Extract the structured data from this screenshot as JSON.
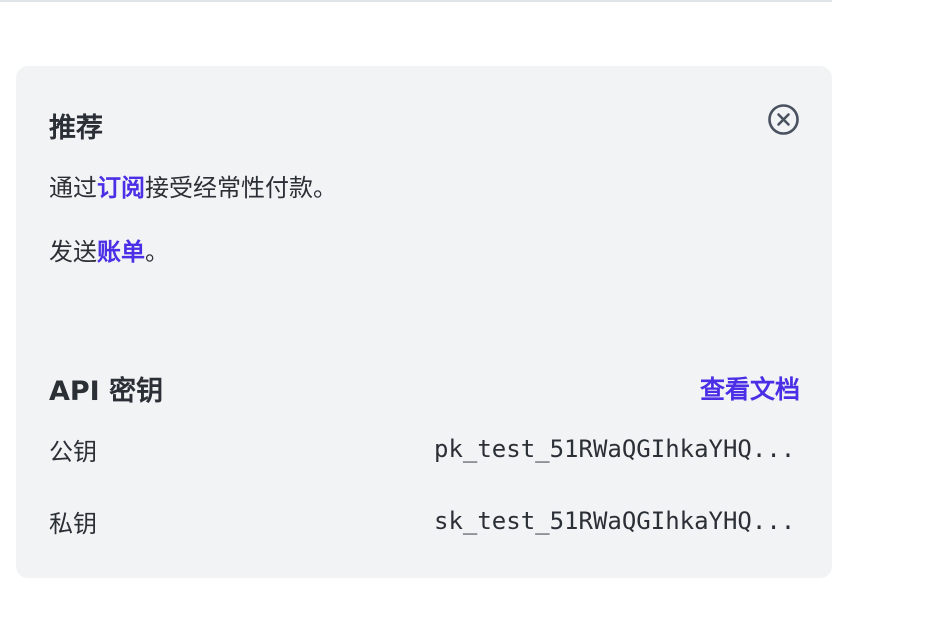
{
  "recommend": {
    "title": "推荐",
    "line1": {
      "before": "通过",
      "link": "订阅",
      "after": "接受经常性付款。"
    },
    "line2": {
      "before": "发送",
      "link": "账单",
      "after": "。"
    },
    "close_icon": "circle-x-icon"
  },
  "api_keys": {
    "title": "API 密钥",
    "docs_link": "查看文档",
    "rows": [
      {
        "label": "公钥",
        "value": "pk_test_51RWaQGIhkaYHQ..."
      },
      {
        "label": "私钥",
        "value": "sk_test_51RWaQGIhkaYHQ..."
      }
    ]
  },
  "colors": {
    "accent": "#4b2ee6",
    "card_bg": "#f2f3f5",
    "text": "#2b2f36"
  }
}
